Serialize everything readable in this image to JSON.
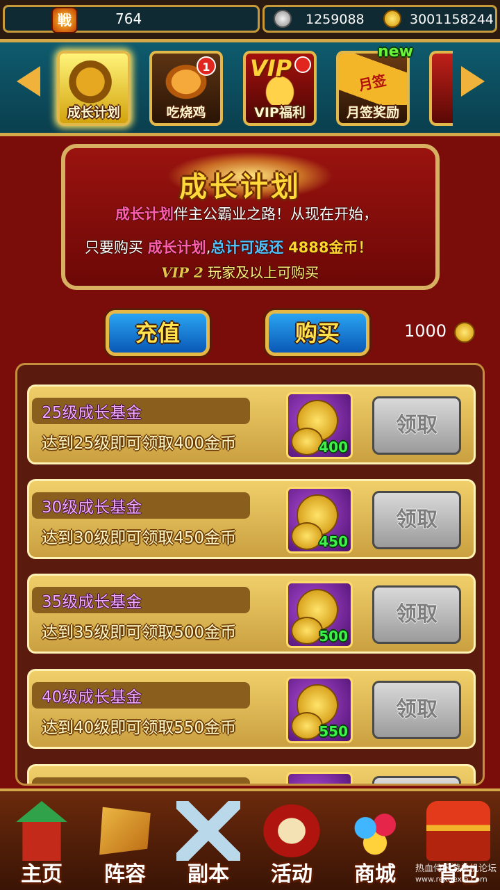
{
  "top_bar": {
    "battle_power_icon_text": "戦",
    "battle_power": "764",
    "silver": "1259088",
    "gold": "3001158244"
  },
  "tabs": [
    {
      "label": "成长计划",
      "icon": "treasure-chest-icon",
      "selected": true
    },
    {
      "label": "吃烧鸡",
      "icon": "roast-chicken-icon",
      "badge": "1"
    },
    {
      "label": "VIP福利",
      "icon": "vip-coins-icon",
      "badge_dot": true,
      "art_text": "VIP"
    },
    {
      "label": "月签奖励",
      "icon": "sign-in-scroll-icon",
      "tag": "new",
      "art_text": "月签"
    }
  ],
  "banner": {
    "title": "成长计划",
    "line1_highlight": "成长计划",
    "line1_rest": "伴主公霸业之路！从现在开始，",
    "line2_prefix": "只要购买",
    "line2_highlight": "成长计划",
    "line2_mid": "总计可返还",
    "line2_amount": "4888金币！",
    "line3_vip": "VIP 2",
    "line3_rest": "玩家及以上可购买"
  },
  "actions": {
    "recharge_label": "充值",
    "buy_label": "购买",
    "price": "1000"
  },
  "funds": [
    {
      "title": "25级成长基金",
      "desc": "达到25级即可领取400金币",
      "amount": "400",
      "button": "领取"
    },
    {
      "title": "30级成长基金",
      "desc": "达到30级即可领取450金币",
      "amount": "450",
      "button": "领取"
    },
    {
      "title": "35级成长基金",
      "desc": "达到35级即可领取500金币",
      "amount": "500",
      "button": "领取"
    },
    {
      "title": "40级成长基金",
      "desc": "达到40级即可领取550金币",
      "amount": "550",
      "button": "领取"
    }
  ],
  "bottom_nav": [
    {
      "label": "主页",
      "icon": "palace-icon"
    },
    {
      "label": "阵容",
      "icon": "war-banner-icon"
    },
    {
      "label": "副本",
      "icon": "crossed-swords-icon"
    },
    {
      "label": "活动",
      "icon": "drum-icon"
    },
    {
      "label": "商城",
      "icon": "gems-icon"
    },
    {
      "label": "背包",
      "icon": "treasure-chest-icon"
    }
  ],
  "watermark": {
    "line1": "热血侍闲游单机论坛",
    "line2": "www.rexuexia.com"
  },
  "colors": {
    "gold_accent": "#d4a848",
    "banner_red": "#9a130f",
    "button_blue": "#1a7fd8",
    "reward_purple": "#7a2aa6"
  }
}
